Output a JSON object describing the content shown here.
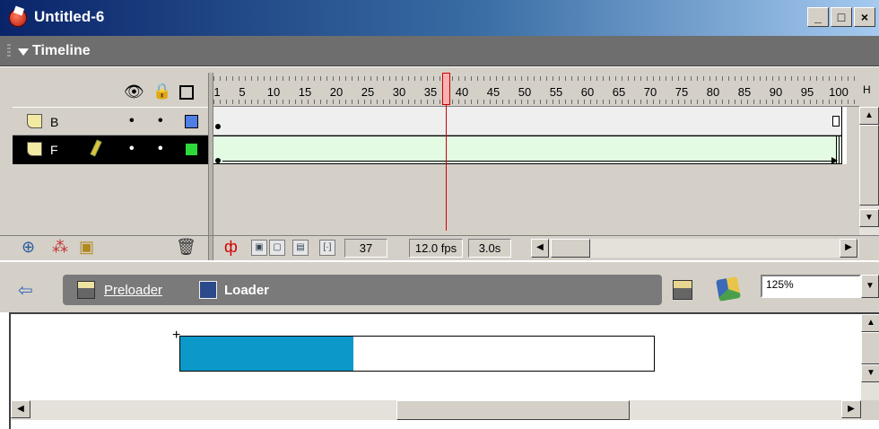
{
  "window": {
    "title": "Untitled-6",
    "buttons": {
      "minimize": "_",
      "maximize": "□",
      "close": "×"
    }
  },
  "panel": {
    "label": "Timeline"
  },
  "layer_header": {
    "icons": [
      "eye-icon",
      "lock-icon",
      "outline-icon"
    ]
  },
  "layers": [
    {
      "name": "B",
      "color": "#4f7fe6",
      "selected": false,
      "icon": "layer-icon"
    },
    {
      "name": "F",
      "color": "#2fd83a",
      "selected": true,
      "icon": "layer-icon"
    }
  ],
  "ruler": {
    "labels": [
      "1",
      "5",
      "10",
      "15",
      "20",
      "25",
      "30",
      "35",
      "40",
      "45",
      "50",
      "55",
      "60",
      "65",
      "70",
      "75",
      "80",
      "85",
      "90",
      "95",
      "100"
    ],
    "options_label": "H"
  },
  "status": {
    "current_frame": "37",
    "frame_rate": "12.0 fps",
    "elapsed_time": "3.0s"
  },
  "editbar": {
    "scene": "Preloader",
    "symbol": "Loader",
    "zoom": "125%"
  },
  "stage": {
    "progress": 0.365,
    "fill_color": "#0c98c8"
  }
}
